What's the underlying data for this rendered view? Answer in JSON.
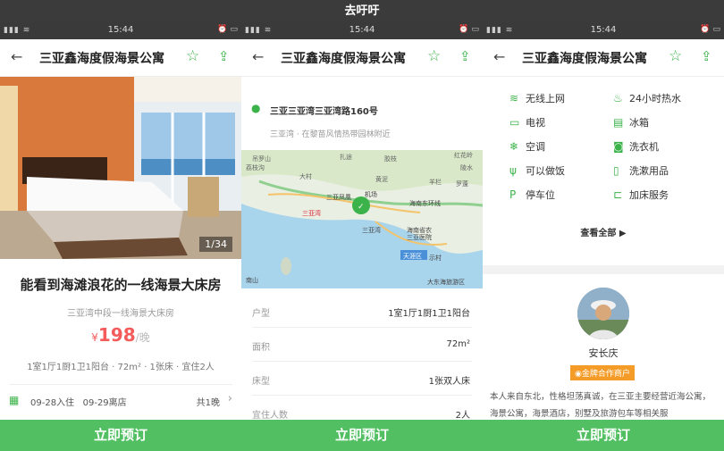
{
  "app_title": "去吁吁",
  "status": {
    "time": "15:44"
  },
  "header": {
    "title": "三亚鑫海度假海景公寓",
    "back_icon": "arrow-left-icon",
    "star_icon": "star-icon",
    "share_icon": "share-icon"
  },
  "booking_button": "立即预订",
  "phone1": {
    "photo_counter": "1/34",
    "room_title": "能看到海滩浪花的一线海景大床房",
    "room_subtitle": "三亚湾中段一线海景大床房",
    "price": {
      "currency": "¥",
      "amount": "198",
      "unit": "/晚"
    },
    "specs": "1室1厅1厨1卫1阳台 · 72m² · 1张床 · 宜住2人",
    "dates": {
      "checkin": "09-28入住",
      "checkout": "09-29离店",
      "nights": "共1晚"
    }
  },
  "phone2": {
    "address": "三亚三亚湾三亚湾路160号",
    "area": "三亚湾 · 在黎苗风情热带园林附近",
    "map_labels": [
      "吊罗山",
      "扎途",
      "红花岭",
      "荔枝沟",
      "胶枝",
      "陵水",
      "大村",
      "黄泥",
      "羊栏",
      "罗蓬",
      "三亚凤凰",
      "机场",
      "海南东环线",
      "三亚湾",
      "三亚湾",
      "海南省农",
      "三亚医院",
      "天涯区",
      "示村",
      "大东海旅游区",
      "南山"
    ],
    "rows": [
      {
        "k": "户型",
        "v": "1室1厅1厨1卫1阳台"
      },
      {
        "k": "面积",
        "v": "72m²"
      },
      {
        "k": "床型",
        "v": "1张双人床"
      },
      {
        "k": "宜住人数",
        "v": "2人"
      }
    ]
  },
  "phone3": {
    "amenities": [
      {
        "icon": "wifi-icon",
        "label": "无线上网"
      },
      {
        "icon": "hot-water-icon",
        "label": "24小时热水"
      },
      {
        "icon": "tv-icon",
        "label": "电视"
      },
      {
        "icon": "fridge-icon",
        "label": "冰箱"
      },
      {
        "icon": "ac-icon",
        "label": "空调"
      },
      {
        "icon": "washer-icon",
        "label": "洗衣机"
      },
      {
        "icon": "cooking-icon",
        "label": "可以做饭"
      },
      {
        "icon": "toiletries-icon",
        "label": "洗漱用品"
      },
      {
        "icon": "parking-icon",
        "label": "停车位"
      },
      {
        "icon": "extra-bed-icon",
        "label": "加床服务"
      }
    ],
    "see_all": "查看全部",
    "host_name": "安长庆",
    "host_badge": "金牌合作商户",
    "host_bio": "本人来自东北，性格坦荡真诚，在三亚主要经营近海公寓，海景公寓，海景酒店，别墅及旅游包车等相关服"
  },
  "colors": {
    "accent": "#3cb34a",
    "price": "#f45c5c",
    "booking": "#52c062",
    "badge": "#f59b27"
  }
}
